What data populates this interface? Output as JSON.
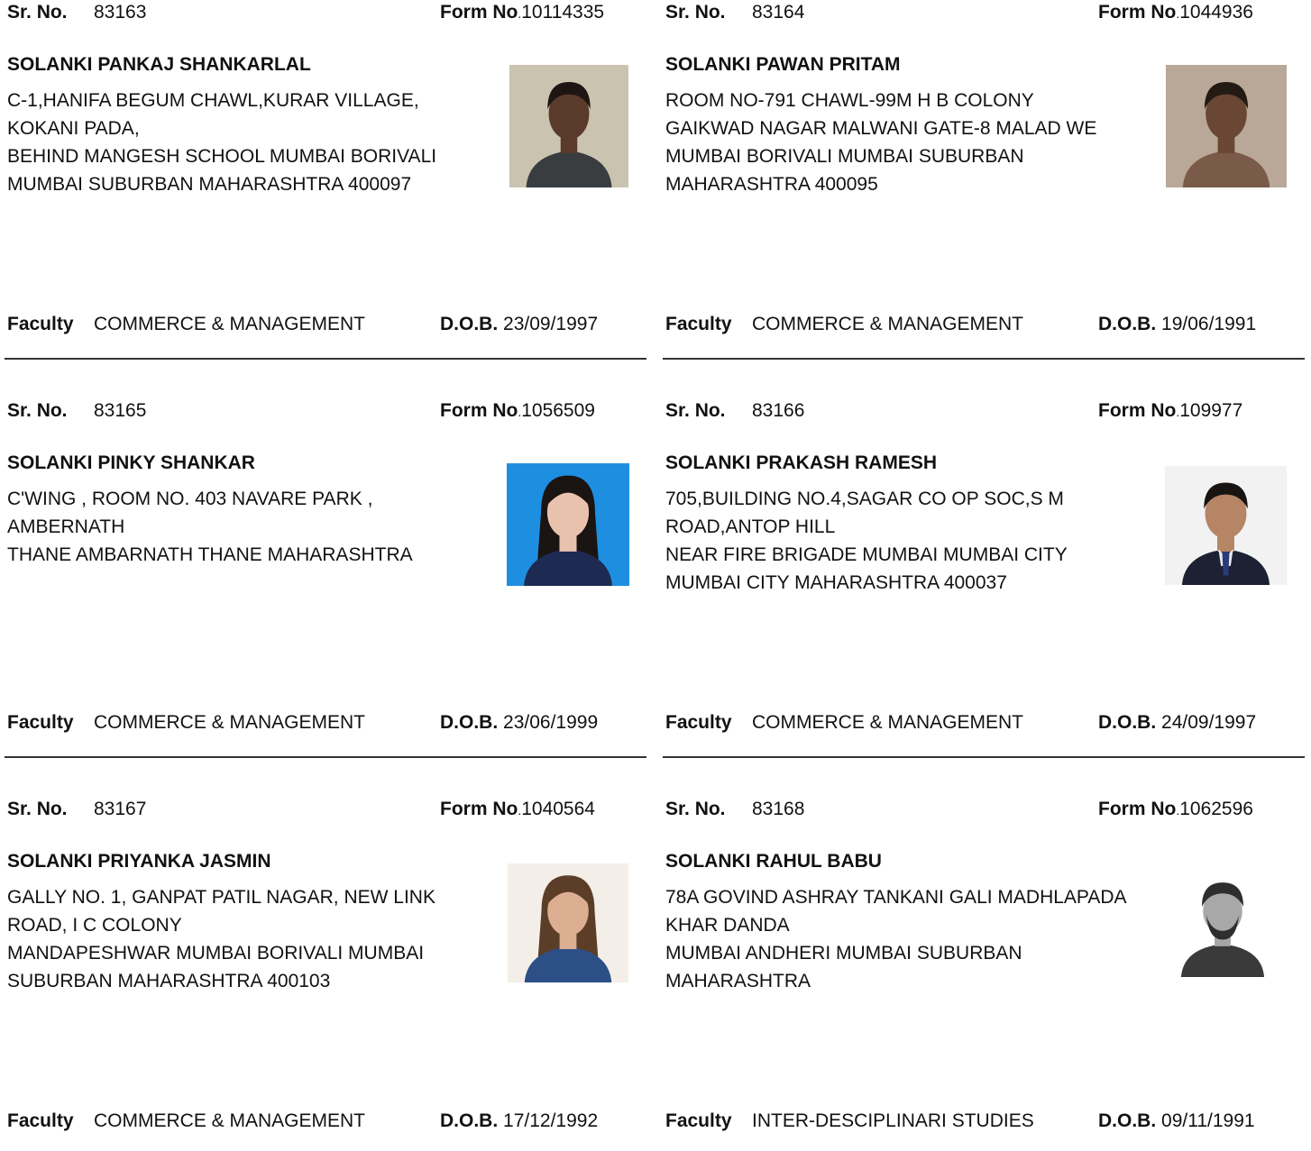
{
  "labels": {
    "sr_no": "Sr. No.",
    "form_no": "Form No",
    "form_no_dot": ".",
    "faculty": "Faculty",
    "dob": "D.O.B."
  },
  "records": [
    {
      "sr_no": "83163",
      "form_no": "10114335",
      "name": "SOLANKI PANKAJ SHANKARLAL",
      "address": [
        "C-1,HANIFA BEGUM CHAWL,KURAR VILLAGE,",
        "KOKANI PADA,",
        "BEHIND MANGESH SCHOOL MUMBAI BORIVALI",
        "MUMBAI SUBURBAN MAHARASHTRA 400097"
      ],
      "faculty": "COMMERCE & MANAGEMENT",
      "dob": "23/09/1997",
      "photo": {
        "background": "#c9c3b0",
        "skin": "#5a3a2a",
        "hair": "#1e1612",
        "clothing": "#3a3d40"
      }
    },
    {
      "sr_no": "83164",
      "form_no": "1044936",
      "name": "SOLANKI PAWAN PRITAM",
      "address": [
        "ROOM NO-791 CHAWL-99M H B COLONY",
        "GAIKWAD NAGAR MALWANI GATE-8 MALAD WE",
        " MUMBAI BORIVALI MUMBAI SUBURBAN",
        "MAHARASHTRA 400095"
      ],
      "faculty": "COMMERCE & MANAGEMENT",
      "dob": "19/06/1991",
      "photo": {
        "background": "#b9a898",
        "skin": "#6a4634",
        "hair": "#241a14",
        "clothing": "#7a5a48"
      }
    },
    {
      "sr_no": "83165",
      "form_no": "1056509",
      "name": "SOLANKI PINKY SHANKAR",
      "address": [
        "C'WING , ROOM NO. 403 NAVARE PARK ,",
        "AMBERNATH",
        " THANE AMBARNATH THANE MAHARASHTRA"
      ],
      "faculty": "COMMERCE & MANAGEMENT",
      "dob": "23/06/1999",
      "photo": {
        "background": "#1e8fe0",
        "skin": "#e9c2ae",
        "hair": "#1a1412",
        "clothing": "#1d2a52"
      }
    },
    {
      "sr_no": "83166",
      "form_no": "109977",
      "name": "SOLANKI PRAKASH RAMESH",
      "address": [
        "705,BUILDING NO.4,SAGAR CO OP SOC,S M",
        "ROAD,ANTOP HILL",
        "NEAR FIRE BRIGADE MUMBAI MUMBAI CITY",
        "MUMBAI CITY MAHARASHTRA 400037"
      ],
      "faculty": "COMMERCE & MANAGEMENT",
      "dob": "24/09/1997",
      "photo": {
        "background": "#f2f2f2",
        "skin": "#b58566",
        "hair": "#181412",
        "clothing": "#1c2233"
      }
    },
    {
      "sr_no": "83167",
      "form_no": "1040564",
      "name": "SOLANKI PRIYANKA JASMIN",
      "address": [
        "GALLY NO. 1, GANPAT PATIL NAGAR, NEW LINK",
        "ROAD, I C COLONY",
        "MANDAPESHWAR MUMBAI BORIVALI MUMBAI",
        "SUBURBAN MAHARASHTRA 400103"
      ],
      "faculty": "COMMERCE & MANAGEMENT",
      "dob": "17/12/1992",
      "photo": {
        "background": "#f3efe8",
        "skin": "#dcae92",
        "hair": "#5b3d28",
        "clothing": "#2c4f86"
      }
    },
    {
      "sr_no": "83168",
      "form_no": "1062596",
      "name": "SOLANKI RAHUL BABU",
      "address": [
        "78A GOVIND ASHRAY TANKANI GALI MADHLAPADA",
        "KHAR DANDA",
        " MUMBAI ANDHERI MUMBAI SUBURBAN",
        "MAHARASHTRA"
      ],
      "faculty": "INTER-DESCIPLINARI STUDIES",
      "dob": "09/11/1991",
      "photo": {
        "background": "#ffffff",
        "skin": "#a8a8a8",
        "hair": "#2e2e2e",
        "clothing": "#3a3a3a"
      }
    }
  ]
}
